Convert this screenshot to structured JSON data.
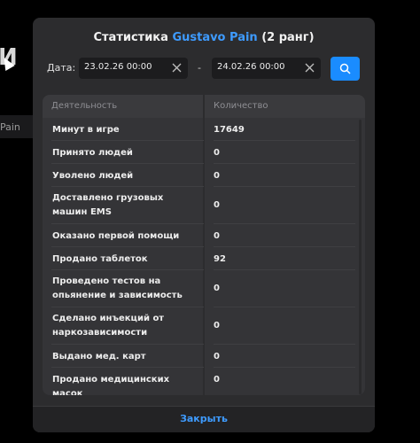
{
  "background": {
    "title_fragment": "И",
    "row_fragment": "Pain"
  },
  "modal": {
    "title_prefix": "Статистика",
    "player_name": "Gustavo Pain",
    "rank": "(2 ранг)",
    "accent_color": "#3e9bff"
  },
  "filters": {
    "date_label": "Дата:",
    "from": "23.02.26 00:00",
    "to": "24.02.26 00:00",
    "separator": "-",
    "clear_icon": "close-icon",
    "search_icon": "search-icon"
  },
  "table": {
    "headers": [
      "Деятельность",
      "Количество"
    ],
    "rows": [
      {
        "activity": "Минут в игре",
        "count": "17649"
      },
      {
        "activity": "Принято людей",
        "count": "0"
      },
      {
        "activity": "Уволено людей",
        "count": "0"
      },
      {
        "activity": "Доставлено грузовых машин EMS",
        "count": "0"
      },
      {
        "activity": "Оказано первой помощи",
        "count": "0"
      },
      {
        "activity": "Продано таблеток",
        "count": "92"
      },
      {
        "activity": "Проведено тестов на опьянение и зависимость",
        "count": "0"
      },
      {
        "activity": "Сделано инъекций от наркозависимости",
        "count": "0"
      },
      {
        "activity": "Выдано мед. карт",
        "count": "0"
      },
      {
        "activity": "Продано медицинских масок",
        "count": "0"
      }
    ]
  },
  "footer": {
    "close_label": "Закрыть"
  }
}
